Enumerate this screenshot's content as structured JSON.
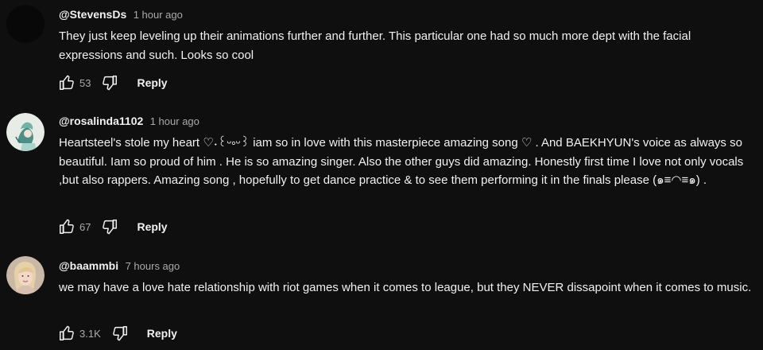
{
  "colors": {
    "background": "#0f0f0f",
    "text_primary": "#f1f1f1",
    "text_secondary": "#aaaaaa"
  },
  "comments": [
    {
      "author": "@StevensDs",
      "time": "1 hour ago",
      "text": "They just keep leveling up their animations further and further. This particular one had so much more dept with the facial expressions and such. Looks so cool",
      "likes": "53",
      "reply_label": "Reply",
      "avatar": "dark-circle-avatar",
      "like_icon": "thumb-up-icon",
      "dislike_icon": "thumb-down-icon"
    },
    {
      "author": "@rosalinda1102",
      "time": "1 hour ago",
      "text": "Heartsteel's stole my heart ♡˖꒰ᵕ༚ᵕ꒱ iam so in love with this masterpiece amazing song ♡ . And BAEKHYUN's voice as always so beautiful. Iam so proud of him . He is so amazing singer. Also the other guys did amazing. Honestly first time I love not only vocals ,but also rappers. Amazing song , hopefully to get dance practice & to see them  performing it in the finals please (๑≡◠≡๑) .",
      "likes": "67",
      "reply_label": "Reply",
      "avatar": "illustrated-avatar",
      "like_icon": "thumb-up-icon",
      "dislike_icon": "thumb-down-icon"
    },
    {
      "author": "@baammbi",
      "time": "7 hours ago",
      "text": "we may have a love hate relationship with riot games when it comes to league, but they NEVER dissapoint when it comes to music.",
      "likes": "3.1K",
      "reply_label": "Reply",
      "avatar": "photo-avatar",
      "like_icon": "thumb-up-icon",
      "dislike_icon": "thumb-down-icon"
    }
  ]
}
